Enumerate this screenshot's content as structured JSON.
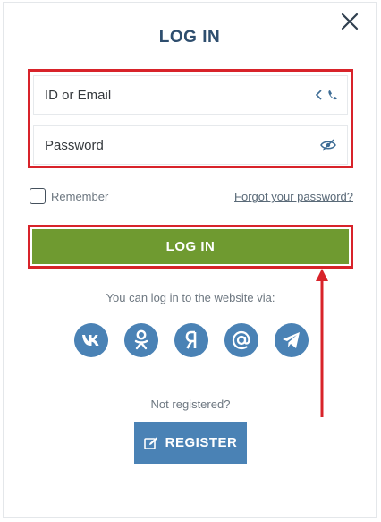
{
  "dialog": {
    "title": "LOG IN",
    "close_icon": "close-icon"
  },
  "form": {
    "id_label": "ID or Email",
    "password_label": "Password",
    "remember_label": "Remember",
    "forgot_link": "Forgot your password?",
    "login_button": "LOG IN"
  },
  "social": {
    "prompt": "You can log in to the website via:",
    "networks": [
      {
        "name": "vk",
        "icon": "vk-icon"
      },
      {
        "name": "odnoklassniki",
        "icon": "odnoklassniki-icon"
      },
      {
        "name": "yandex",
        "icon": "yandex-icon"
      },
      {
        "name": "mail",
        "icon": "at-icon"
      },
      {
        "name": "telegram",
        "icon": "telegram-icon"
      }
    ]
  },
  "register": {
    "prompt": "Not registered?",
    "button": "REGISTER"
  },
  "colors": {
    "title": "#2e4e6e",
    "login_button": "#6f9a30",
    "accent_blue": "#4a82b5",
    "highlight_red": "#d8232a"
  }
}
